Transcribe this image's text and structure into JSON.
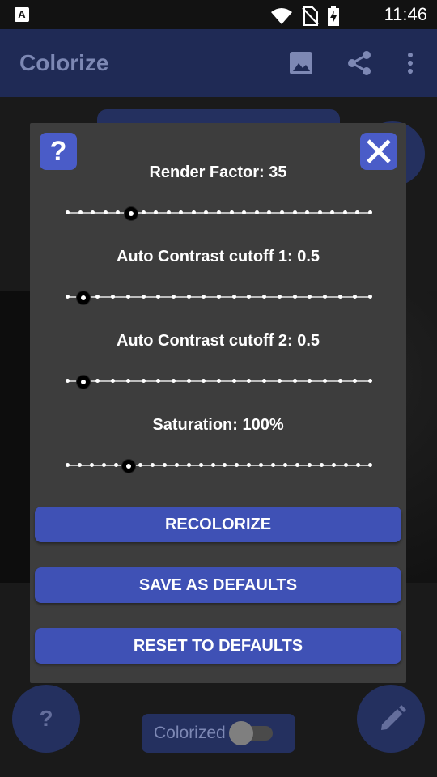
{
  "status_bar": {
    "time": "11:46",
    "notification_letter": "A"
  },
  "app_bar": {
    "title": "Colorize",
    "icons": [
      "image-icon",
      "share-icon",
      "more-vert-icon"
    ]
  },
  "background": {
    "toggle_label": "Colorized",
    "toggle_on": false,
    "help_fab_glyph": "?"
  },
  "dialog": {
    "help_glyph": "?",
    "sliders": [
      {
        "label": "Render Factor: 35",
        "steps": 25,
        "value_index": 5
      },
      {
        "label": "Auto Contrast cutoff 1: 0.5",
        "steps": 21,
        "value_index": 1
      },
      {
        "label": "Auto Contrast cutoff 2: 0.5",
        "steps": 21,
        "value_index": 1
      },
      {
        "label": "Saturation: 100%",
        "steps": 26,
        "value_index": 5
      }
    ],
    "buttons": {
      "recolorize": "RECOLORIZE",
      "save_defaults": "SAVE AS DEFAULTS",
      "reset_defaults": "RESET TO DEFAULTS"
    }
  },
  "colors": {
    "accent": "#3f51b5",
    "dialog_bg": "#3d3d3d",
    "appbar_bg": "#1f2a55"
  }
}
